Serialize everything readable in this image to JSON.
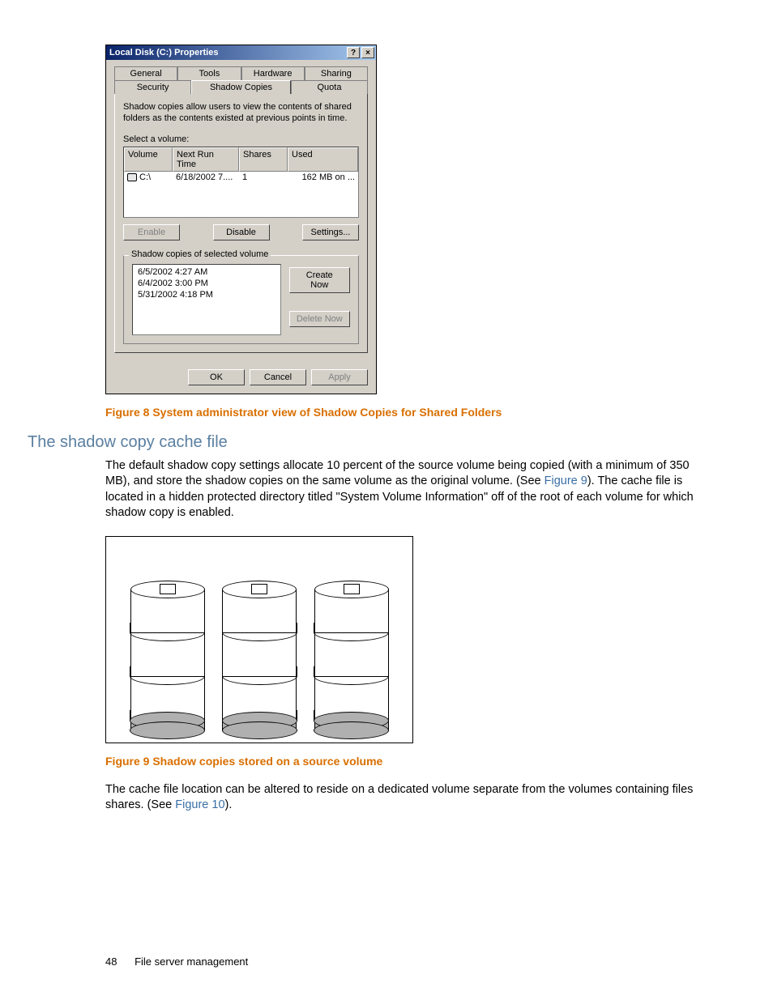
{
  "dialog": {
    "title": "Local Disk (C:) Properties",
    "tabs_row1": [
      "General",
      "Tools",
      "Hardware",
      "Sharing"
    ],
    "tabs_row2": [
      "Security",
      "Shadow Copies",
      "Quota"
    ],
    "active_tab": "Shadow Copies",
    "intro": "Shadow copies allow users to view the contents of shared folders as the contents existed at previous points in time.",
    "select_label": "Select a volume:",
    "columns": {
      "vol": "Volume",
      "nrt": "Next Run Time",
      "shares": "Shares",
      "used": "Used"
    },
    "row": {
      "vol": "C:\\",
      "nrt": "6/18/2002 7....",
      "shares": "1",
      "used": "162 MB on ..."
    },
    "btn_enable": "Enable",
    "btn_disable": "Disable",
    "btn_settings": "Settings...",
    "group_title": "Shadow copies of selected volume",
    "copies": [
      "6/5/2002 4:27 AM",
      "6/4/2002 3:00 PM",
      "5/31/2002 4:18 PM"
    ],
    "btn_create": "Create Now",
    "btn_delete": "Delete Now",
    "btn_ok": "OK",
    "btn_cancel": "Cancel",
    "btn_apply": "Apply"
  },
  "captions": {
    "fig8": "Figure 8 System administrator view of Shadow Copies for Shared Folders",
    "fig9": "Figure 9 Shadow copies stored on a source volume"
  },
  "section_heading": "The shadow copy cache file",
  "para1_pre": "The default shadow copy settings allocate 10 percent of the source volume being copied (with a minimum of 350 MB), and store the shadow copies on the same volume as the original volume. (See ",
  "para1_link": "Figure 9",
  "para1_post": "). The cache file is located in a hidden protected directory titled \"System Volume Information\" off of the root of each volume for which shadow copy is enabled.",
  "para2_pre": "The cache file location can be altered to reside on a dedicated volume separate from the volumes containing files shares. (See ",
  "para2_link": "Figure 10",
  "para2_post": ").",
  "footer": {
    "page": "48",
    "section": "File server management"
  }
}
